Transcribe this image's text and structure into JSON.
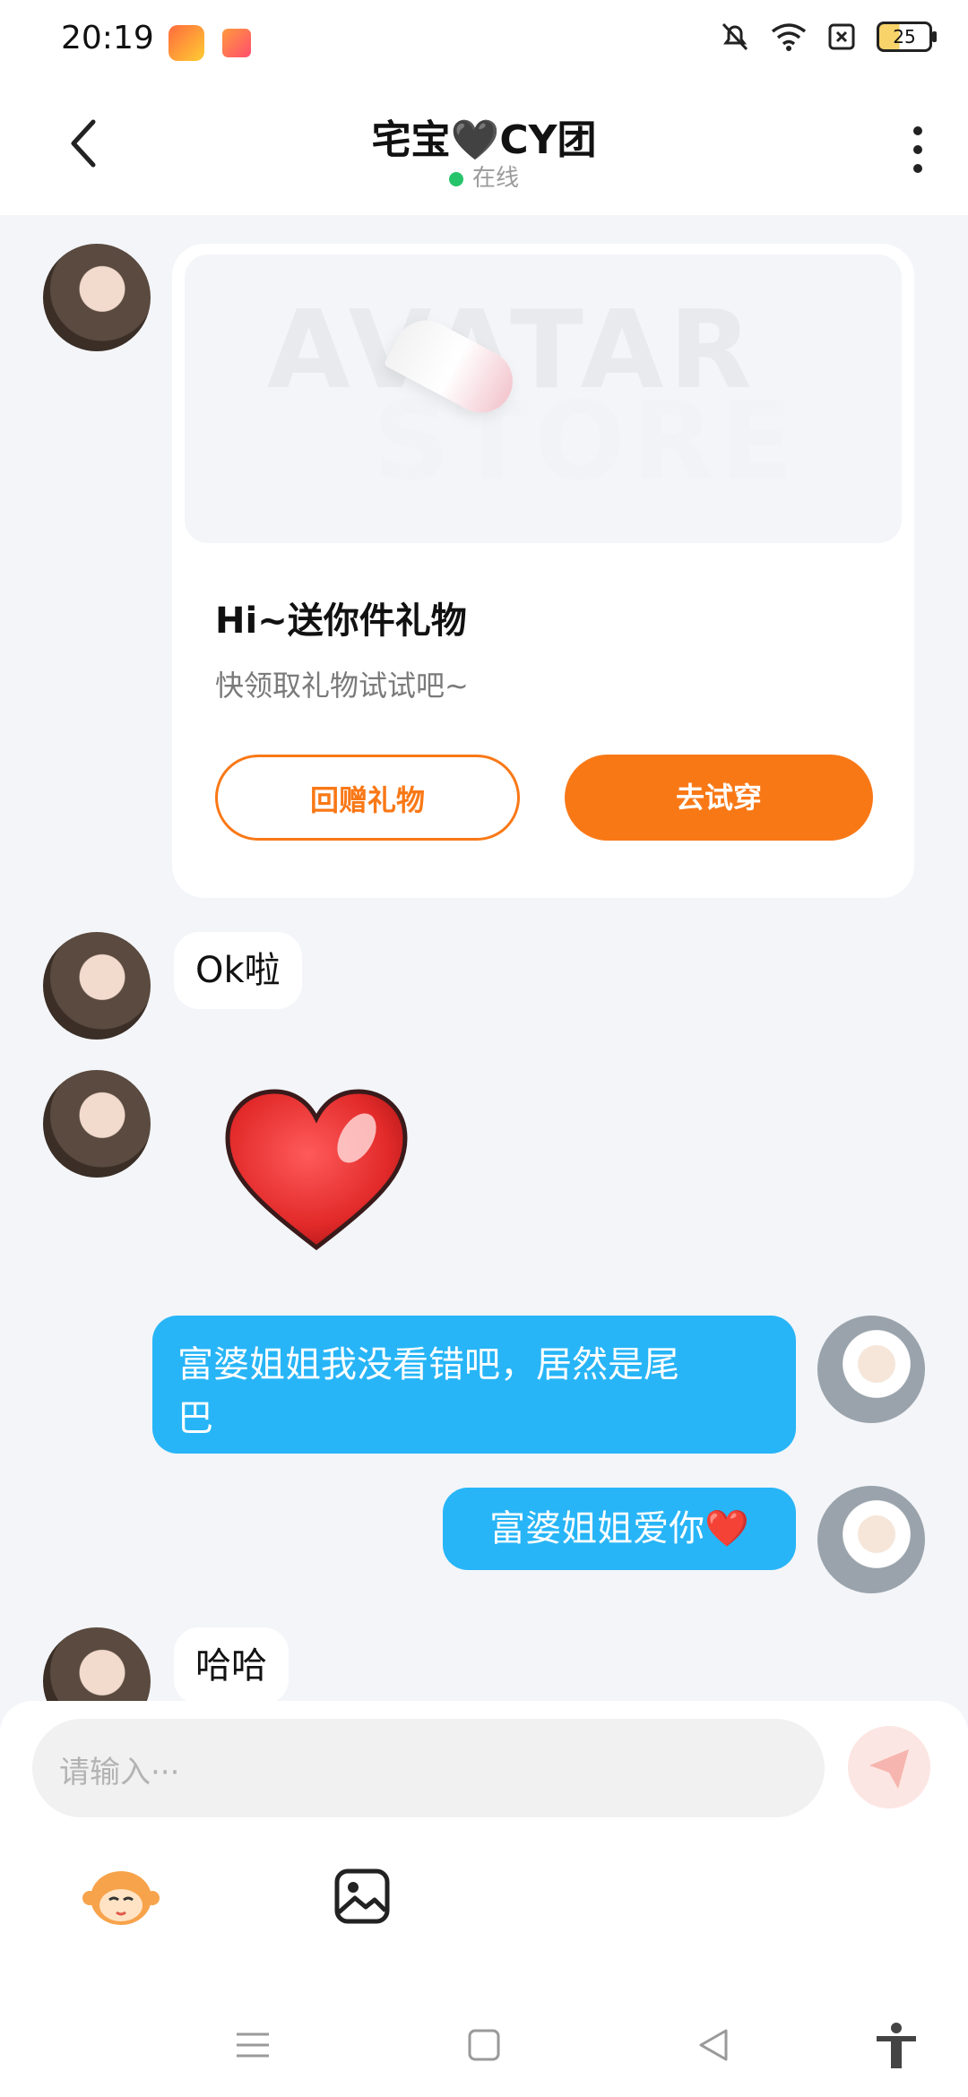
{
  "status_bar": {
    "time": "20:19",
    "battery": "25",
    "icons": [
      "app-icon-1",
      "game-icon",
      "mute-bell-icon",
      "wifi-icon",
      "sim-x-icon",
      "battery-icon"
    ]
  },
  "header": {
    "title": "宅宝🖤CY团",
    "status": "在线"
  },
  "gift_card": {
    "watermark_line1": "AVATAR",
    "watermark_line2": "STORE",
    "title": "Hi~送你件礼物",
    "subtitle": "快领取礼物试试吧~",
    "return_gift_label": "回赠礼物",
    "try_on_label": "去试穿"
  },
  "messages": [
    {
      "side": "left",
      "text": "Ok啦"
    },
    {
      "side": "left",
      "sticker": "heart-sticker"
    },
    {
      "side": "right",
      "text_line1": "富婆姐姐我没看错吧，居然是尾",
      "text_line2": "巴"
    },
    {
      "side": "right",
      "text": "富婆姐姐爱你❤️"
    },
    {
      "side": "left",
      "text": "哈哈"
    }
  ],
  "composer": {
    "placeholder": "请输入···"
  },
  "colors": {
    "accent_orange": "#f97816",
    "bubble_blue": "#27b5f7",
    "online_green": "#26c46a"
  }
}
